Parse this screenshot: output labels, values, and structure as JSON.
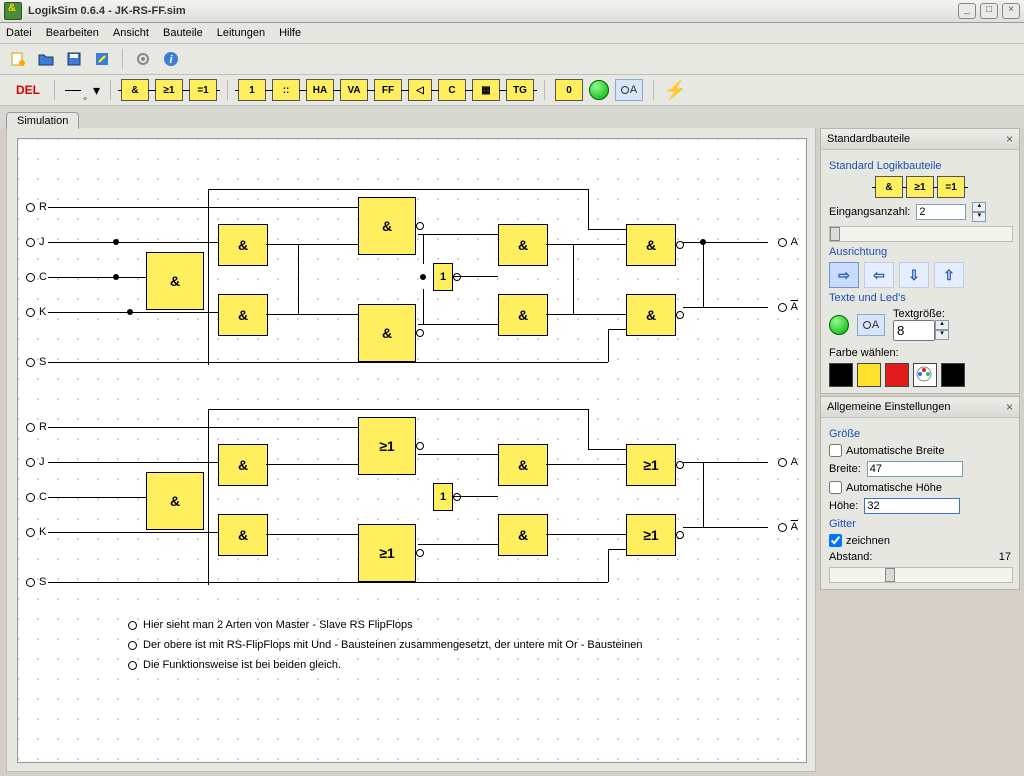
{
  "app": {
    "title": "LogikSim 0.6.4 - JK-RS-FF.sim"
  },
  "menu": {
    "file": "Datei",
    "edit": "Bearbeiten",
    "view": "Ansicht",
    "components": "Bauteile",
    "wires": "Leitungen",
    "help": "Hilfe"
  },
  "tool2": {
    "del": "DEL",
    "and": "&",
    "or": "≥1",
    "xor": "=1",
    "id": "1",
    "delay": "::",
    "ha": "HA",
    "va": "VA",
    "ff": "FF",
    "mux": "◁",
    "clk": "C",
    "mem": "▦",
    "tg": "TG",
    "zero": "0",
    "txt": "A"
  },
  "tab": {
    "sim": "Simulation"
  },
  "pins": {
    "R": "R",
    "J": "J",
    "C": "C",
    "K": "K",
    "S": "S",
    "A": "A",
    "Ainv": "A"
  },
  "notes": {
    "n1": "Hier sieht man 2 Arten von Master - Slave RS FlipFlops",
    "n2": "Der obere ist mit RS-FlipFlops mit Und - Bausteinen zusammengesetzt, der untere mit Or - Bausteinen",
    "n3": "Die Funktionsweise ist bei beiden gleich."
  },
  "pStd": {
    "hdr": "Standardbauteile",
    "sec1": "Standard Logikbauteile",
    "and": "&",
    "or": "≥1",
    "xor": "=1",
    "inLabel": "Eingangsanzahl:",
    "inVal": "2",
    "sec2": "Ausrichtung",
    "sec3": "Texte und Led's",
    "textSize": "Textgröße:",
    "textSizeVal": "8",
    "colorLabel": "Farbe wählen:"
  },
  "pGen": {
    "hdr": "Allgemeine Einstellungen",
    "sizeSec": "Größe",
    "autoW": "Automatische Breite",
    "wLabel": "Breite:",
    "wVal": "47",
    "autoH": "Automatische Höhe",
    "hLabel": "Höhe:",
    "hVal": "32",
    "gridSec": "Gitter",
    "draw": "zeichnen",
    "distLabel": "Abstand:",
    "distVal": "17"
  }
}
